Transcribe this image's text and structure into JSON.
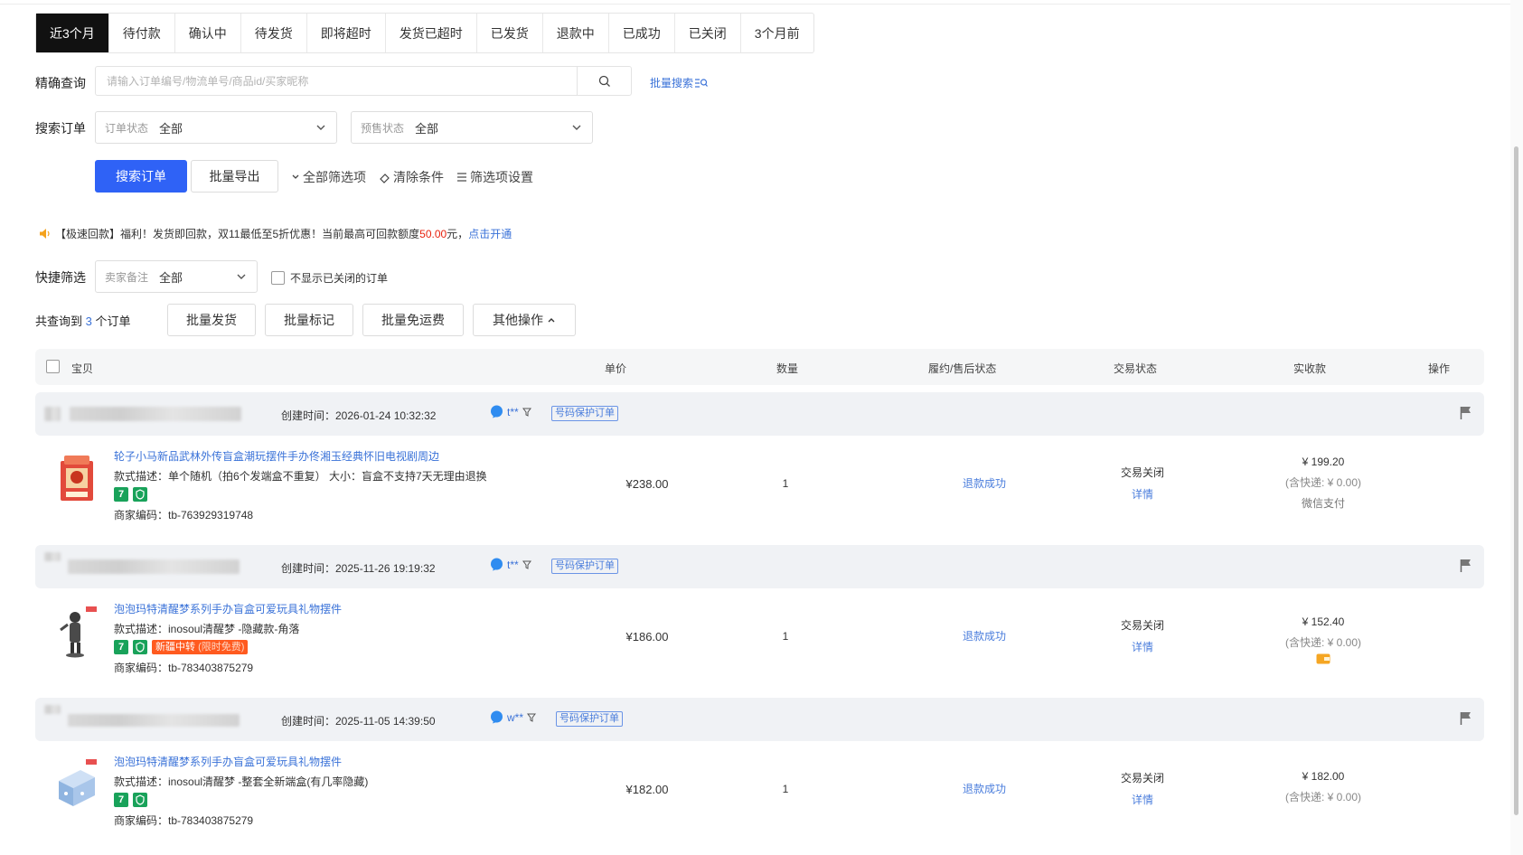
{
  "tabs": [
    {
      "label": "近3个月",
      "active": true
    },
    {
      "label": "待付款"
    },
    {
      "label": "确认中"
    },
    {
      "label": "待发货"
    },
    {
      "label": "即将超时"
    },
    {
      "label": "发货已超时"
    },
    {
      "label": "已发货"
    },
    {
      "label": "退款中"
    },
    {
      "label": "已成功"
    },
    {
      "label": "已关闭"
    },
    {
      "label": "3个月前"
    }
  ],
  "search": {
    "label": "精确查询",
    "placeholder": "请输入订单编号/物流单号/商品id/买家昵称",
    "batch_search": "批量搜索"
  },
  "filters": {
    "label": "搜索订单",
    "order_status": {
      "label": "订单状态",
      "value": "全部"
    },
    "presale_status": {
      "label": "预售状态",
      "value": "全部"
    }
  },
  "actions": {
    "search_button": "搜索订单",
    "export_button": "批量导出",
    "all_filters": "全部筛选项",
    "clear_filters": "清除条件",
    "filter_settings": "筛选项设置"
  },
  "promo": {
    "text": "【极速回款】福利！发货即回款，双11最低至5折优惠！当前最高可回款额度",
    "amount": "50.00",
    "unit": "元，",
    "link": "点击开通"
  },
  "quick_filter": {
    "label": "快捷筛选",
    "seller_note": {
      "label": "卖家备注",
      "value": "全部"
    },
    "hide_closed": "不显示已关闭的订单"
  },
  "summary": {
    "prefix": "共查询到",
    "count": "3",
    "suffix": "个订单"
  },
  "bulk_actions": {
    "ship": "批量发货",
    "mark": "批量标记",
    "free_shipping": "批量免运费",
    "more": "其他操作"
  },
  "table_header": {
    "item": "宝贝",
    "unit_price": "单价",
    "quantity": "数量",
    "fulfillment": "履约/售后状态",
    "trade_status": "交易状态",
    "paid": "实收款",
    "operation": "操作"
  },
  "orders": [
    {
      "created": "创建时间：2026-01-24 10:32:32",
      "buyer": "t**",
      "protect_tag": "号码保护订单",
      "title": "轮子小马新品武林外传盲盒潮玩摆件手办佟湘玉经典怀旧电视剧周边",
      "spec": "款式描述：单个随机（拍6个发端盒不重复）  大小：盲盒不支持7天无理由退换",
      "merchant_code": "商家编码：tb-763929319748",
      "price": "¥238.00",
      "qty": "1",
      "refund_status": "退款成功",
      "trade_status": "交易关闭",
      "detail": "详情",
      "paid": "¥ 199.20",
      "shipping": "(含快递: ¥ 0.00)",
      "pay_method": "微信支付"
    },
    {
      "created": "创建时间：2025-11-26 19:19:32",
      "buyer": "t**",
      "protect_tag": "号码保护订单",
      "title": "泡泡玛特清醒梦系列手办盲盒可爱玩具礼物摆件",
      "spec": "款式描述：inosoul清醒梦 -隐藏款-角落",
      "merchant_code": "商家编码：tb-783403875279",
      "xinjiang": "新疆中转",
      "xinjiang_sub": "(限时免费)",
      "price": "¥186.00",
      "qty": "1",
      "refund_status": "退款成功",
      "trade_status": "交易关闭",
      "detail": "详情",
      "paid": "¥ 152.40",
      "shipping": "(含快递: ¥ 0.00)"
    },
    {
      "created": "创建时间：2025-11-05 14:39:50",
      "buyer": "w**",
      "protect_tag": "号码保护订单",
      "title": "泡泡玛特清醒梦系列手办盲盒可爱玩具礼物摆件",
      "spec": "款式描述：inosoul清醒梦 -整套全新端盒(有几率隐藏)",
      "merchant_code": "商家编码：tb-783403875279",
      "price": "¥182.00",
      "qty": "1",
      "refund_status": "退款成功",
      "trade_status": "交易关闭",
      "detail": "详情",
      "paid": "¥ 182.00",
      "shipping": "(含快递: ¥ 0.00)"
    }
  ],
  "colors": {
    "primary": "#2f62f6",
    "link": "#3a72d8",
    "tab_active": "#111111",
    "promo_red": "#e8230f",
    "badge_green": "#19a25a",
    "badge_orange": "#ff5a1f"
  }
}
